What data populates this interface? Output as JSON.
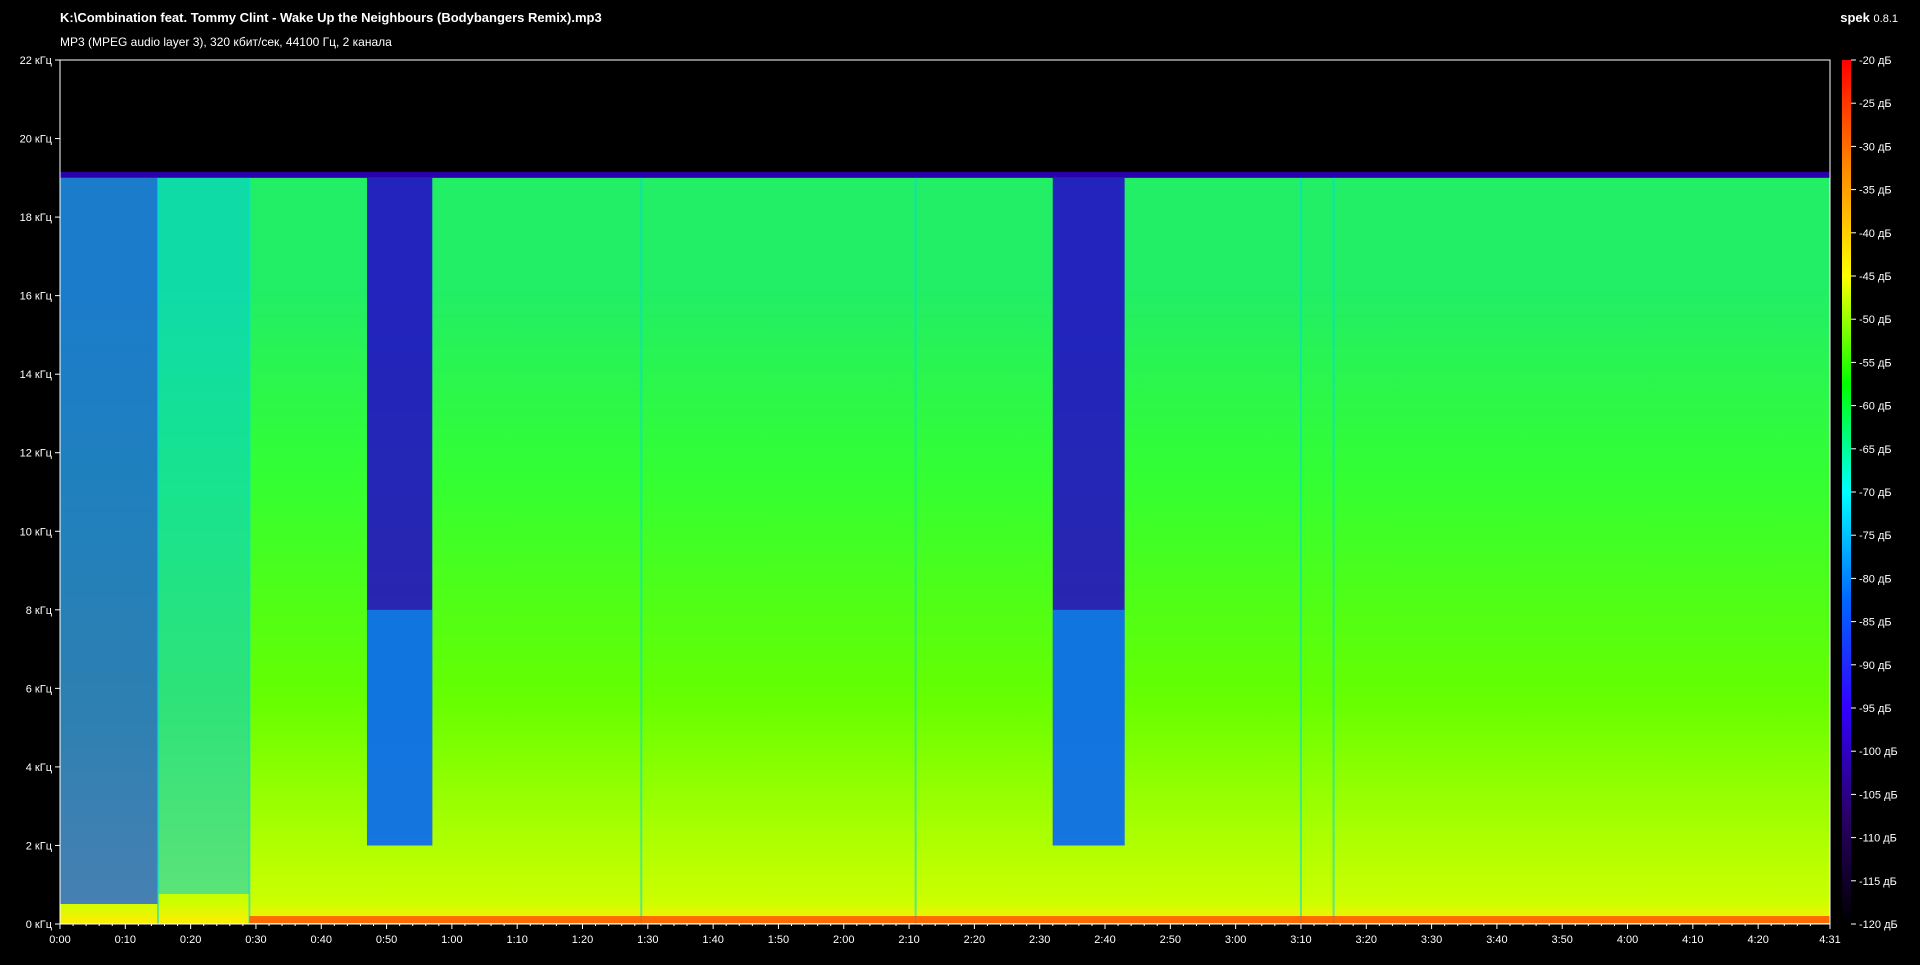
{
  "header": {
    "file_title": "K:\\Combination feat. Tommy Clint - Wake Up the Neighbours (Bodybangers Remix).mp3",
    "info": "MP3 (MPEG audio layer 3), 320 кбит/сек, 44100 Гц, 2 канала",
    "app_name": "spek",
    "app_version": "0.8.1"
  },
  "chart_data": {
    "type": "heatmap",
    "x_range_seconds": [
      0,
      271
    ],
    "y_range_khz": [
      0,
      22
    ],
    "color_range_db": [
      -120,
      -20
    ],
    "x_ticks": [
      {
        "value": 0,
        "label": "0:00"
      },
      {
        "value": 10,
        "label": "0:10"
      },
      {
        "value": 20,
        "label": "0:20"
      },
      {
        "value": 30,
        "label": "0:30"
      },
      {
        "value": 40,
        "label": "0:40"
      },
      {
        "value": 50,
        "label": "0:50"
      },
      {
        "value": 60,
        "label": "1:00"
      },
      {
        "value": 70,
        "label": "1:10"
      },
      {
        "value": 80,
        "label": "1:20"
      },
      {
        "value": 90,
        "label": "1:30"
      },
      {
        "value": 100,
        "label": "1:40"
      },
      {
        "value": 110,
        "label": "1:50"
      },
      {
        "value": 120,
        "label": "2:00"
      },
      {
        "value": 130,
        "label": "2:10"
      },
      {
        "value": 140,
        "label": "2:20"
      },
      {
        "value": 150,
        "label": "2:30"
      },
      {
        "value": 160,
        "label": "2:40"
      },
      {
        "value": 170,
        "label": "2:50"
      },
      {
        "value": 180,
        "label": "3:00"
      },
      {
        "value": 190,
        "label": "3:10"
      },
      {
        "value": 200,
        "label": "3:20"
      },
      {
        "value": 210,
        "label": "3:30"
      },
      {
        "value": 220,
        "label": "3:40"
      },
      {
        "value": 230,
        "label": "3:50"
      },
      {
        "value": 240,
        "label": "4:00"
      },
      {
        "value": 250,
        "label": "4:10"
      },
      {
        "value": 260,
        "label": "4:20"
      },
      {
        "value": 271,
        "label": "4:31"
      }
    ],
    "y_ticks": [
      {
        "value": 0,
        "label": "0 кГц"
      },
      {
        "value": 2,
        "label": "2 кГц"
      },
      {
        "value": 4,
        "label": "4 кГц"
      },
      {
        "value": 6,
        "label": "6 кГц"
      },
      {
        "value": 8,
        "label": "8 кГц"
      },
      {
        "value": 10,
        "label": "10 кГц"
      },
      {
        "value": 12,
        "label": "12 кГц"
      },
      {
        "value": 14,
        "label": "14 кГц"
      },
      {
        "value": 16,
        "label": "16 кГц"
      },
      {
        "value": 18,
        "label": "18 кГц"
      },
      {
        "value": 20,
        "label": "20 кГц"
      },
      {
        "value": 22,
        "label": "22 кГц"
      }
    ],
    "colorbar_ticks": [
      {
        "value": -20,
        "label": "-20 дБ"
      },
      {
        "value": -25,
        "label": "-25 дБ"
      },
      {
        "value": -30,
        "label": "-30 дБ"
      },
      {
        "value": -35,
        "label": "-35 дБ"
      },
      {
        "value": -40,
        "label": "-40 дБ"
      },
      {
        "value": -45,
        "label": "-45 дБ"
      },
      {
        "value": -50,
        "label": "-50 дБ"
      },
      {
        "value": -55,
        "label": "-55 дБ"
      },
      {
        "value": -60,
        "label": "-60 дБ"
      },
      {
        "value": -65,
        "label": "-65 дБ"
      },
      {
        "value": -70,
        "label": "-70 дБ"
      },
      {
        "value": -75,
        "label": "-75 дБ"
      },
      {
        "value": -80,
        "label": "-80 дБ"
      },
      {
        "value": -85,
        "label": "-85 дБ"
      },
      {
        "value": -90,
        "label": "-90 дБ"
      },
      {
        "value": -95,
        "label": "-95 дБ"
      },
      {
        "value": -100,
        "label": "-100 дБ"
      },
      {
        "value": -105,
        "label": "-105 дБ"
      },
      {
        "value": -110,
        "label": "-110 дБ"
      },
      {
        "value": -115,
        "label": "-115 дБ"
      },
      {
        "value": -120,
        "label": "-120 дБ"
      }
    ],
    "colormap": [
      "#000000",
      "#2a0066",
      "#3300ff",
      "#0066ff",
      "#00ffff",
      "#00ff00",
      "#ffff00",
      "#ff8800",
      "#ff0000"
    ],
    "spectral_cutoff_khz": 19,
    "quiet_sections_seconds": [
      [
        47,
        57
      ],
      [
        152,
        163
      ]
    ],
    "section_boundaries_seconds": [
      15,
      29,
      89,
      131,
      190,
      195
    ]
  }
}
